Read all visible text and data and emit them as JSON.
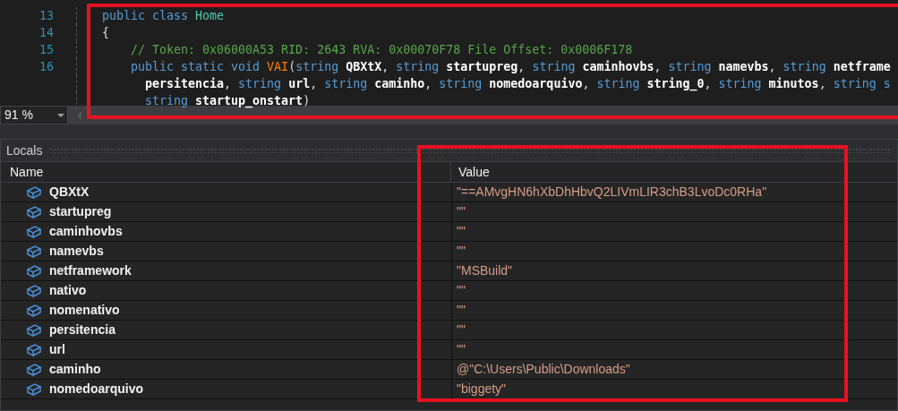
{
  "editor": {
    "lines": [
      {
        "number": "13",
        "rows": [
          {
            "segments": [
              {
                "kind": "keyword",
                "text": "public class "
              },
              {
                "kind": "type",
                "text": "Home"
              }
            ]
          }
        ]
      },
      {
        "number": "14",
        "rows": [
          {
            "segments": [
              {
                "kind": "plain",
                "text": "{"
              }
            ]
          }
        ],
        "children": [
          {
            "number": "15",
            "rows": [
              {
                "segments": [
                  {
                    "kind": "comment",
                    "text": "// Token: 0x06000A53 RID: 2643 RVA: 0x00070F78 File Offset: 0x0006F178"
                  }
                ]
              }
            ]
          },
          {
            "number": "16",
            "rows": [
              {
                "segments": [
                  {
                    "kind": "keyword",
                    "text": "public static void "
                  },
                  {
                    "kind": "method",
                    "text": "VAI"
                  },
                  {
                    "kind": "plain",
                    "text": "("
                  },
                  {
                    "kind": "keyword",
                    "text": "string "
                  },
                  {
                    "kind": "param",
                    "text": "QBXtX"
                  },
                  {
                    "kind": "plain",
                    "text": ", "
                  },
                  {
                    "kind": "keyword",
                    "text": "string "
                  },
                  {
                    "kind": "param",
                    "text": "startupreg"
                  },
                  {
                    "kind": "plain",
                    "text": ", "
                  },
                  {
                    "kind": "keyword",
                    "text": "string "
                  },
                  {
                    "kind": "param",
                    "text": "caminhovbs"
                  },
                  {
                    "kind": "plain",
                    "text": ", "
                  },
                  {
                    "kind": "keyword",
                    "text": "string "
                  },
                  {
                    "kind": "param",
                    "text": "namevbs"
                  },
                  {
                    "kind": "plain",
                    "text": ", "
                  },
                  {
                    "kind": "keyword",
                    "text": "string "
                  },
                  {
                    "kind": "param",
                    "text": "netframe"
                  }
                ]
              },
              {
                "segments": [
                  {
                    "kind": "param",
                    "text": "persitencia"
                  },
                  {
                    "kind": "plain",
                    "text": ", "
                  },
                  {
                    "kind": "keyword",
                    "text": "string "
                  },
                  {
                    "kind": "param",
                    "text": "url"
                  },
                  {
                    "kind": "plain",
                    "text": ", "
                  },
                  {
                    "kind": "keyword",
                    "text": "string "
                  },
                  {
                    "kind": "param",
                    "text": "caminho"
                  },
                  {
                    "kind": "plain",
                    "text": ", "
                  },
                  {
                    "kind": "keyword",
                    "text": "string "
                  },
                  {
                    "kind": "param",
                    "text": "nomedoarquivo"
                  },
                  {
                    "kind": "plain",
                    "text": ", "
                  },
                  {
                    "kind": "keyword",
                    "text": "string "
                  },
                  {
                    "kind": "param",
                    "text": "string_0"
                  },
                  {
                    "kind": "plain",
                    "text": ", "
                  },
                  {
                    "kind": "keyword",
                    "text": "string "
                  },
                  {
                    "kind": "param",
                    "text": "minutos"
                  },
                  {
                    "kind": "plain",
                    "text": ", "
                  },
                  {
                    "kind": "keyword",
                    "text": "string s"
                  }
                ]
              },
              {
                "segments": [
                  {
                    "kind": "keyword",
                    "text": "string "
                  },
                  {
                    "kind": "param",
                    "text": "startup_onstart"
                  },
                  {
                    "kind": "plain",
                    "text": ")"
                  }
                ]
              }
            ]
          }
        ]
      }
    ]
  },
  "zoom": {
    "value": "91 %"
  },
  "locals": {
    "title": "Locals",
    "columns": [
      "Name",
      "Value"
    ],
    "rows": [
      {
        "name": "QBXtX",
        "value": "\"==AMvgHN6hXbDhHbvQ2LIVmLIR3chB3LvoDc0RHa\""
      },
      {
        "name": "startupreg",
        "value": "\"\""
      },
      {
        "name": "caminhovbs",
        "value": "\"\""
      },
      {
        "name": "namevbs",
        "value": "\"\""
      },
      {
        "name": "netframework",
        "value": "\"MSBuild\""
      },
      {
        "name": "nativo",
        "value": "\"\""
      },
      {
        "name": "nomenativo",
        "value": "\"\""
      },
      {
        "name": "persitencia",
        "value": "\"\""
      },
      {
        "name": "url",
        "value": "\"\""
      },
      {
        "name": "caminho",
        "value": "@\"C:\\Users\\Public\\Downloads\""
      },
      {
        "name": "nomedoarquivo",
        "value": "\"biggety\""
      }
    ]
  }
}
